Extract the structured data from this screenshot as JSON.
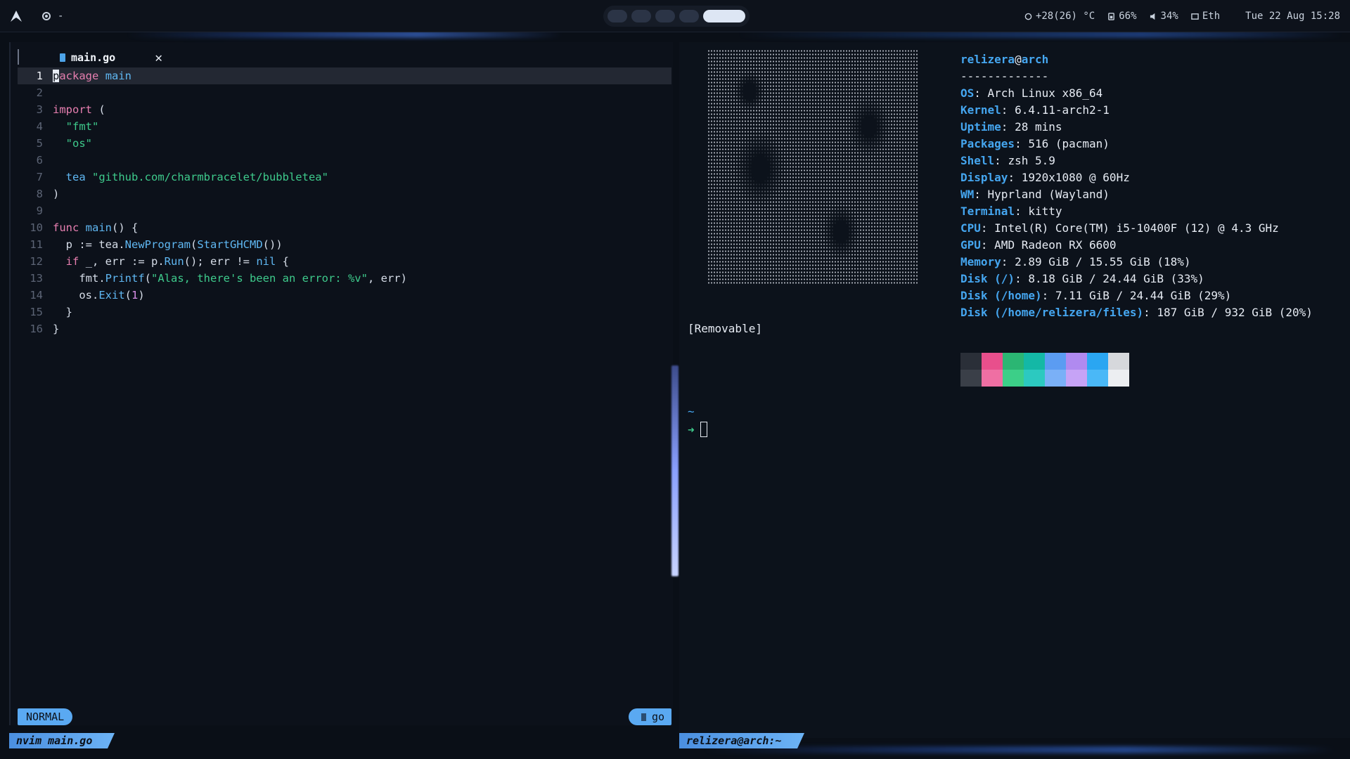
{
  "topbar": {
    "left_text": "-",
    "temperature": "+28(26) °C",
    "battery": "66%",
    "volume": "34%",
    "network": "Eth",
    "datetime": "Tue 22 Aug 15:28"
  },
  "nvim": {
    "tab_label": "main.go",
    "tab_close": "✕",
    "lines": [
      {
        "n": "1"
      },
      {
        "n": "2"
      },
      {
        "n": "3"
      },
      {
        "n": "4"
      },
      {
        "n": "5"
      },
      {
        "n": "6"
      },
      {
        "n": "7"
      },
      {
        "n": "8"
      },
      {
        "n": "9"
      },
      {
        "n": "10"
      },
      {
        "n": "11"
      },
      {
        "n": "12"
      },
      {
        "n": "13"
      },
      {
        "n": "14"
      },
      {
        "n": "15"
      },
      {
        "n": "16"
      }
    ],
    "code": {
      "l1a": "p",
      "l1b": "ackage",
      "l1c": "main",
      "l3a": "import",
      "l3b": "(",
      "l4": "\"fmt\"",
      "l5": "\"os\"",
      "l7a": "tea",
      "l7b": "\"github.com/charmbracelet/bubbletea\"",
      "l8": ")",
      "l10a": "func",
      "l10b": "main",
      "l10c": "() {",
      "l11a": "p := tea.",
      "l11b": "NewProgram",
      "l11c": "(",
      "l11d": "StartGHCMD",
      "l11e": "())",
      "l12a": "if",
      "l12b": "_, err := p.",
      "l12c": "Run",
      "l12d": "(); err != ",
      "l12e": "nil",
      "l12f": "{",
      "l13a": "fmt.",
      "l13b": "Printf",
      "l13c": "(",
      "l13d": "\"Alas, there's been an error: %v\"",
      "l13e": ", err)",
      "l14a": "os.",
      "l14b": "Exit",
      "l14c": "(",
      "l14d": "1",
      "l14e": ")",
      "l15": "}",
      "l16": "}"
    },
    "status": {
      "mode": "NORMAL",
      "file": "main.go",
      "filetype": "go"
    },
    "window_title": "nvim main.go"
  },
  "terminal": {
    "removable": "[Removable]",
    "user": "relizera",
    "at": "@",
    "host": "arch",
    "separator": "-------------",
    "info": [
      {
        "key": "OS",
        "value": "Arch Linux x86_64"
      },
      {
        "key": "Kernel",
        "value": "6.4.11-arch2-1"
      },
      {
        "key": "Uptime",
        "value": "28 mins"
      },
      {
        "key": "Packages",
        "value": "516 (pacman)"
      },
      {
        "key": "Shell",
        "value": "zsh 5.9"
      },
      {
        "key": "Display",
        "value": "1920x1080 @ 60Hz"
      },
      {
        "key": "WM",
        "value": "Hyprland (Wayland)"
      },
      {
        "key": "Terminal",
        "value": "kitty"
      },
      {
        "key": "CPU",
        "value": "Intel(R) Core(TM) i5-10400F (12) @ 4.3 GHz"
      },
      {
        "key": "GPU",
        "value": "AMD Radeon RX 6600"
      },
      {
        "key": "Memory",
        "value": "2.89 GiB / 15.55 GiB (18%)"
      },
      {
        "key": "Disk (/)",
        "value": "8.18 GiB / 24.44 GiB (33%)"
      },
      {
        "key": "Disk (/home)",
        "value": "7.11 GiB / 24.44 GiB (29%)"
      },
      {
        "key": "Disk (/home/relizera/files)",
        "value": "187 GiB / 932 GiB (20%)"
      }
    ],
    "palette": {
      "top": [
        "#2a2f38",
        "#e84f8c",
        "#2bb673",
        "#14b8a6",
        "#5b9cf2",
        "#b08af0",
        "#2aa6f2",
        "#d6d8dc"
      ],
      "bottom": [
        "#3a3f48",
        "#ef6fa3",
        "#3ccf88",
        "#2cc9c0",
        "#7ab0f7",
        "#c6a3f6",
        "#4ab8f7",
        "#eceef1"
      ]
    },
    "prompt_dir": "~",
    "prompt_arrow": "➜",
    "window_title": "relizera@arch:~"
  }
}
